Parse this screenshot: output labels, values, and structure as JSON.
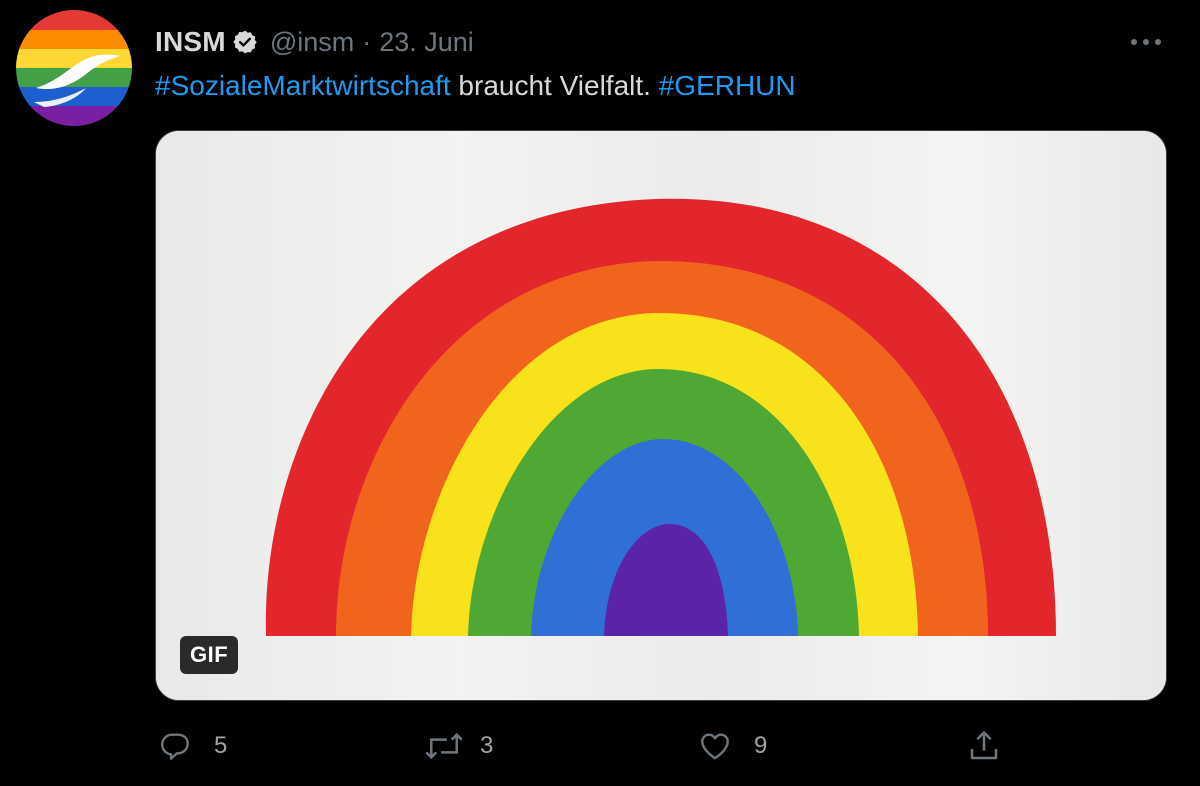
{
  "tweet": {
    "display_name": "INSM",
    "handle": "@insm",
    "separator": "·",
    "date": "23. Juni",
    "text_hashtag_1": "#SozialeMarktwirtschaft",
    "text_body": " braucht Vielfalt. ",
    "text_hashtag_2": "#GERHUN",
    "media_badge": "GIF"
  },
  "actions": {
    "reply_count": "5",
    "retweet_count": "3",
    "like_count": "9"
  },
  "icons": {
    "verified": "verified-badge-icon",
    "more": "more-options-icon",
    "reply": "reply-icon",
    "retweet": "retweet-icon",
    "like": "like-icon",
    "share": "share-icon"
  },
  "colors": {
    "background": "#000000",
    "text": "#d9d9d9",
    "secondary": "#6e767d",
    "link": "#1d9bf0"
  }
}
